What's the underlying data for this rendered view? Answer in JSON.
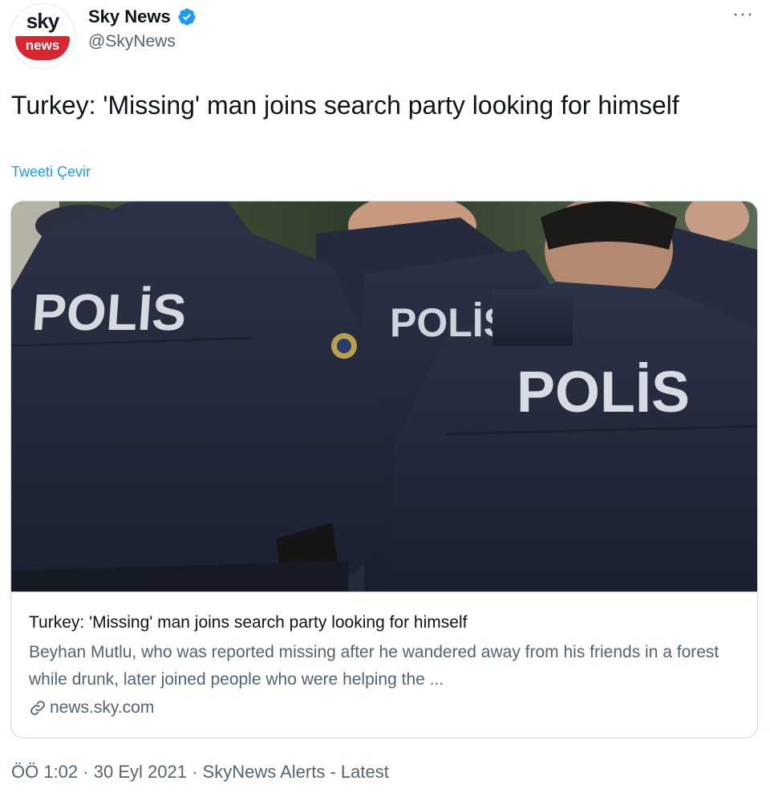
{
  "author": {
    "avatar_top": "sky",
    "avatar_bottom": "news",
    "display_name": "Sky News",
    "handle": "@SkyNews",
    "verified_icon": "verified-badge-icon"
  },
  "more_label": "···",
  "tweet": {
    "text": "Turkey: 'Missing' man joins search party looking for himself",
    "translate_label": "Tweeti Çevir"
  },
  "card": {
    "image_labels": [
      "POLİS",
      "POLİS",
      "POLİS"
    ],
    "title": "Turkey: 'Missing' man joins search party looking for himself",
    "description": "Beyhan Mutlu, who was reported missing after he wandered away from his friends in a forest while drunk, later joined people who were helping the ...",
    "domain": "news.sky.com",
    "domain_icon": "link-icon"
  },
  "meta": {
    "time": "ÖÖ 1:02",
    "date": "30 Eyl 2021",
    "source": "SkyNews Alerts - Latest",
    "separator": "·"
  },
  "colors": {
    "accent": "#1d9bf0",
    "sky_red": "#d7262e",
    "uniform": "#232a3b"
  }
}
